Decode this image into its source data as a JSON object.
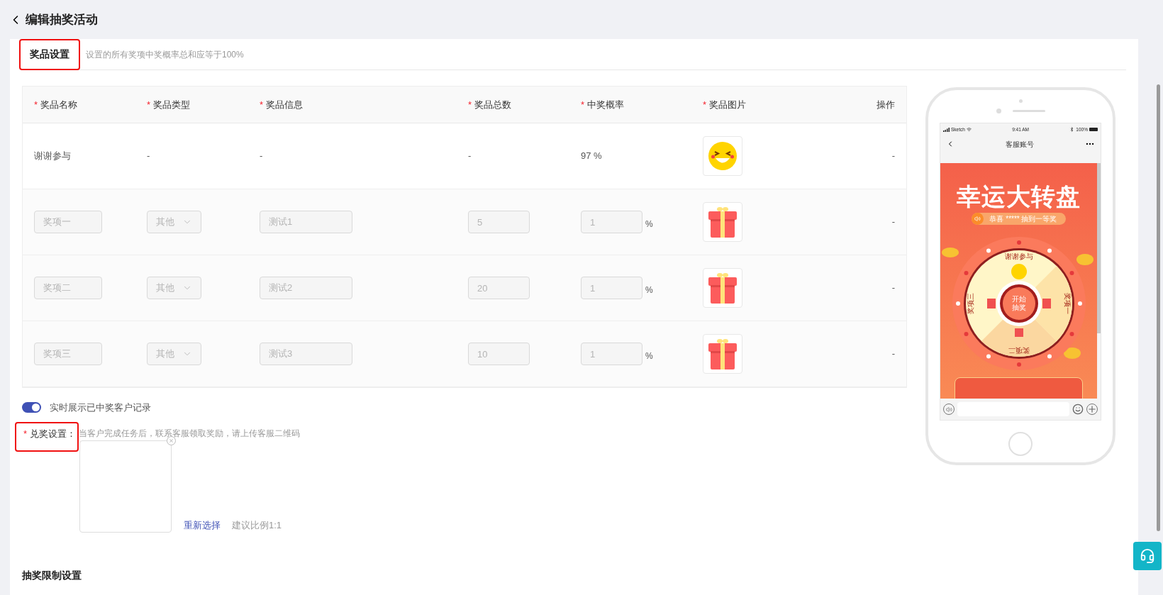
{
  "page": {
    "title": "编辑抽奖活动"
  },
  "section_tab": {
    "label": "奖品设置",
    "hint": "设置的所有奖项中奖概率总和应等于100%"
  },
  "prize_table": {
    "columns": [
      {
        "label": "奖品名称",
        "required_mark": "*"
      },
      {
        "label": "奖品类型",
        "required_mark": "*"
      },
      {
        "label": "奖品信息",
        "required_mark": "*"
      },
      {
        "label": "奖品总数",
        "required_mark": "*"
      },
      {
        "label": "中奖概率",
        "required_mark": "*"
      },
      {
        "label": "奖品图片",
        "required_mark": "*"
      },
      {
        "label": "操作"
      }
    ],
    "rows": [
      {
        "kind": "fixed",
        "name": "谢谢参与",
        "type": "-",
        "info": "-",
        "total": "-",
        "rate": "97 %",
        "operation": "-"
      },
      {
        "kind": "editable",
        "disabled": true,
        "name": "奖项一",
        "type": "其他",
        "info": "测试1",
        "total": "5",
        "rate": "1",
        "rate_unit": "%",
        "operation": "-"
      },
      {
        "kind": "editable",
        "disabled": true,
        "name": "奖项二",
        "type": "其他",
        "info": "测试2",
        "total": "20",
        "rate": "1",
        "rate_unit": "%",
        "operation": "-"
      },
      {
        "kind": "editable",
        "disabled": true,
        "name": "奖项三",
        "type": "其他",
        "info": "测试3",
        "total": "10",
        "rate": "1",
        "rate_unit": "%",
        "operation": "-"
      }
    ]
  },
  "live_winners_toggle": {
    "label": "实时展示已中奖客户记录",
    "on": true
  },
  "redeem": {
    "required_mark": "*",
    "label": "兑奖设置：",
    "hint": "当客户完成任务后，联系客服领取奖励，请上传客服二维码",
    "reselect_link": "重新选择",
    "ratio_hint": "建议比例1:1"
  },
  "limits_section": {
    "title": "抽奖限制设置"
  },
  "phone_preview": {
    "carrier": "Sketch",
    "time": "9:41 AM",
    "battery": "100%",
    "nav_title": "客服账号",
    "banner_title": "幸运大转盘",
    "marquee": "恭喜 ***** 抽到一等奖",
    "start_button": "开始抽奖",
    "wheel_segments": [
      "谢谢参与",
      "奖项一",
      "奖项二",
      "奖项三"
    ]
  }
}
